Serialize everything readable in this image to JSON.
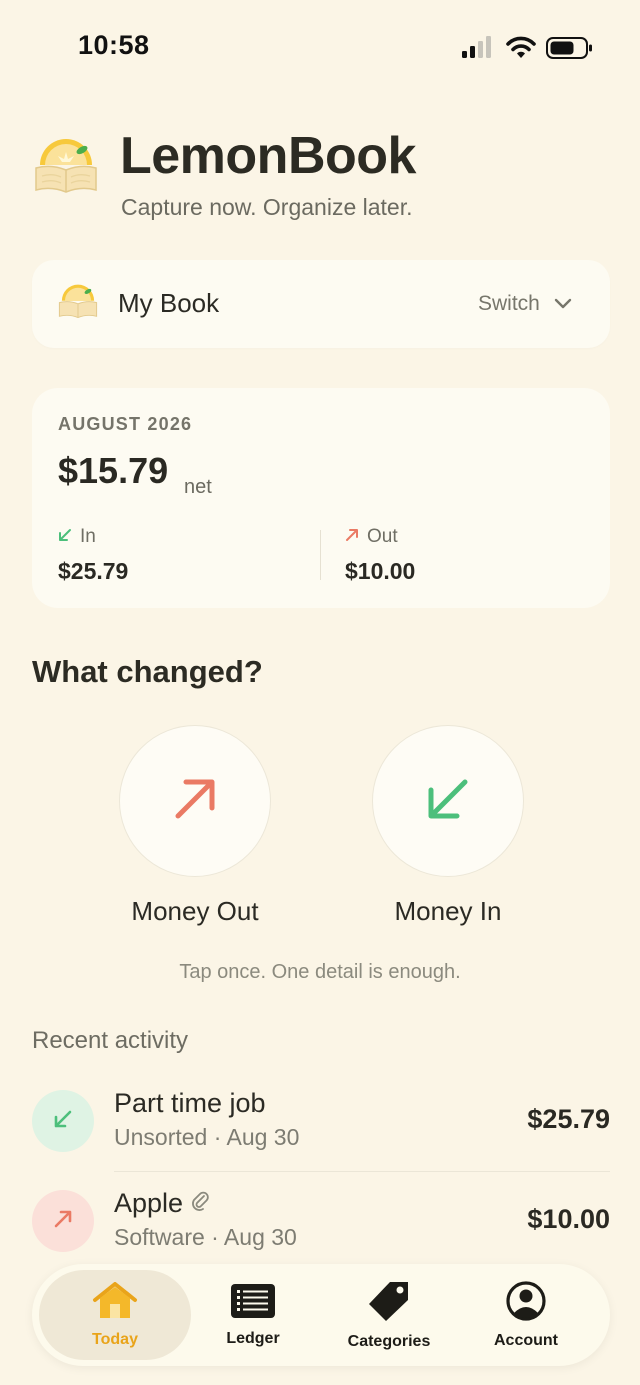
{
  "status_bar": {
    "time": "10:58"
  },
  "header": {
    "app_name": "LemonBook",
    "tagline": "Capture now. Organize later."
  },
  "book": {
    "name": "My Book",
    "switch_label": "Switch"
  },
  "summary": {
    "month": "AUGUST 2026",
    "net_amount": "$15.79",
    "net_label": "net",
    "in_label": "In",
    "in_amount": "$25.79",
    "out_label": "Out",
    "out_amount": "$10.00"
  },
  "what_changed": {
    "title": "What changed?",
    "money_out_label": "Money Out",
    "money_in_label": "Money In",
    "hint": "Tap once. One detail is enough."
  },
  "recent": {
    "title": "Recent activity",
    "items": [
      {
        "name": "Part time job",
        "subtitle": "Unsorted · Aug 30",
        "amount": "$25.79",
        "direction": "in"
      },
      {
        "name": "Apple",
        "subtitle": "Software · Aug 30",
        "amount": "$10.00",
        "direction": "out",
        "has_attachment": true
      }
    ]
  },
  "tabs": [
    {
      "label": "Today",
      "icon": "home-icon",
      "active": true
    },
    {
      "label": "Ledger",
      "icon": "ledger-icon",
      "active": false
    },
    {
      "label": "Categories",
      "icon": "tag-icon",
      "active": false
    },
    {
      "label": "Account",
      "icon": "account-icon",
      "active": false
    }
  ],
  "colors": {
    "background": "#fbf5e6",
    "card": "#fdfbf2",
    "in_green": "#4cbf7b",
    "out_red": "#ea7a64",
    "accent": "#e9a41a"
  }
}
